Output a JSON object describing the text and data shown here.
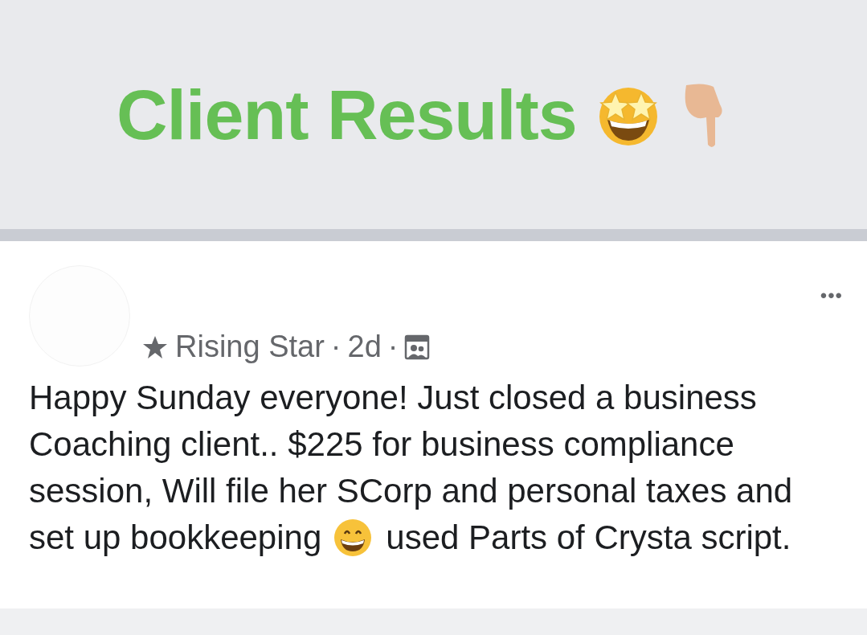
{
  "header": {
    "title": "Client Results"
  },
  "post": {
    "badge": "Rising Star",
    "separator_1": "·",
    "time": "2d",
    "separator_2": "·",
    "more": "•••",
    "text_lines": [
      "Happy Sunday everyone! Just closed a business",
      "Coaching client.. $225 for business compliance",
      "session, Will file her SCorp and personal taxes and"
    ],
    "last_line_before_emoji": "set up bookkeeping",
    "last_line_after_emoji": "used Parts of Crysta script."
  }
}
